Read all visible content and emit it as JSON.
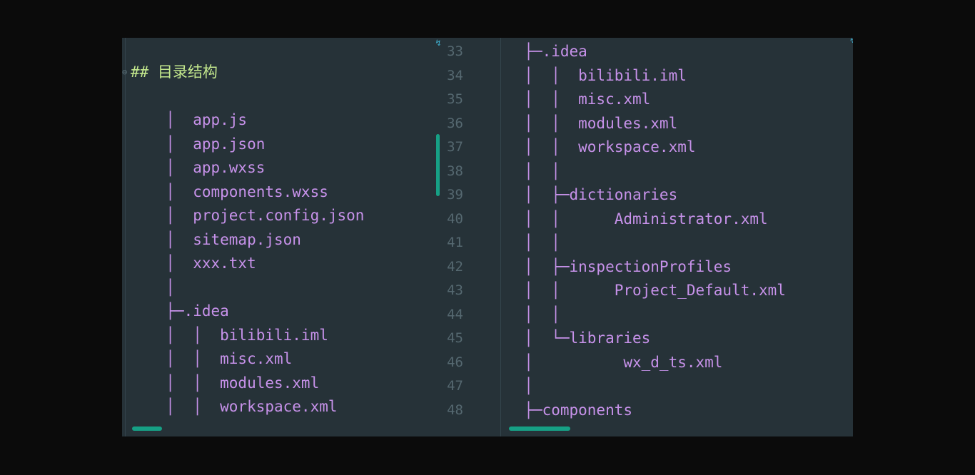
{
  "left_editor": {
    "heading": "## 目录结构",
    "lines": [
      "  │  app.js",
      "  │  app.json",
      "  │  app.wxss",
      "  │  components.wxss",
      "  │  project.config.json",
      "  │  sitemap.json",
      "  │  xxx.txt",
      "  │",
      "  ├─.idea",
      "  │  │  bilibili.iml",
      "  │  │  misc.xml",
      "  │  │  modules.xml",
      "  │  │  workspace.xml"
    ]
  },
  "right_editor": {
    "line_numbers": [
      "33",
      "34",
      "35",
      "36",
      "37",
      "38",
      "39",
      "40",
      "41",
      "42",
      "43",
      "44",
      "45",
      "46",
      "47",
      "48"
    ],
    "lines": [
      "  ├─.idea",
      "  │  │  bilibili.iml",
      "  │  │  misc.xml",
      "  │  │  modules.xml",
      "  │  │  workspace.xml",
      "  │  │",
      "  │  ├─dictionaries",
      "  │  │      Administrator.xml",
      "  │  │",
      "  │  ├─inspectionProfiles",
      "  │  │      Project_Default.xml",
      "  │  │",
      "  │  └─libraries",
      "  │          wx_d_ts.xml",
      "  │",
      "  ├─components"
    ]
  },
  "colors": {
    "background": "#263238",
    "text": "#c792ea",
    "heading": "#c3e88d",
    "line_number": "#556870",
    "scrollbar": "#16a085"
  },
  "icons": {
    "fold": "fold-marker-icon",
    "wrap": "soft-wrap-icon"
  }
}
